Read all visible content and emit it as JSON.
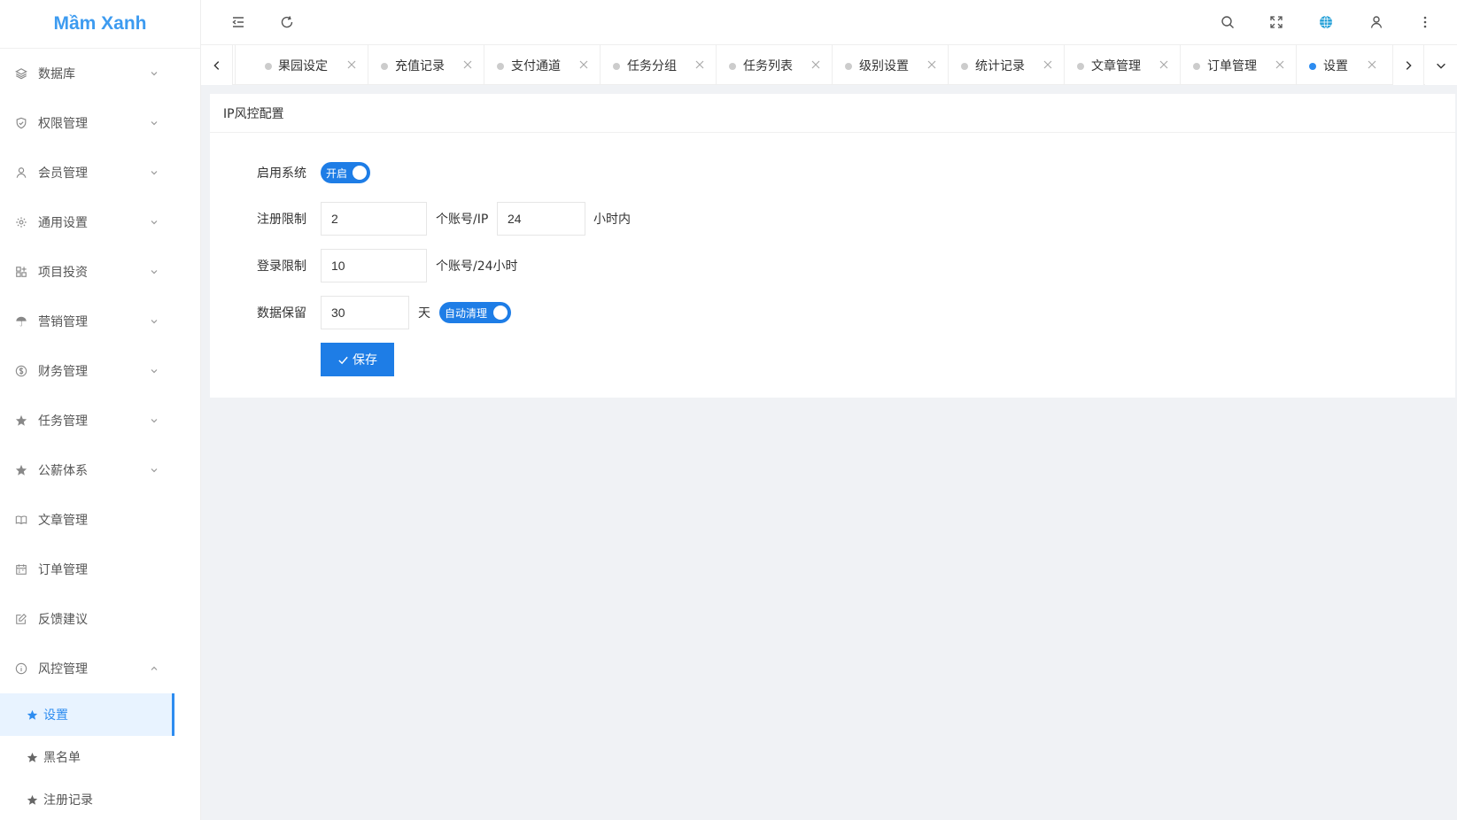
{
  "app": {
    "logo": "Mầm Xanh"
  },
  "sidebar": {
    "items": [
      {
        "label": "数据库",
        "icon": "layers-icon"
      },
      {
        "label": "权限管理",
        "icon": "shield-icon"
      },
      {
        "label": "会员管理",
        "icon": "user-icon"
      },
      {
        "label": "通用设置",
        "icon": "gear-icon"
      },
      {
        "label": "项目投资",
        "icon": "grid-icon"
      },
      {
        "label": "营销管理",
        "icon": "umbrella-icon"
      },
      {
        "label": "财务管理",
        "icon": "dollar-icon"
      },
      {
        "label": "任务管理",
        "icon": "star-icon"
      },
      {
        "label": "公薪体系",
        "icon": "star-icon"
      },
      {
        "label": "文章管理",
        "icon": "book-icon"
      },
      {
        "label": "订单管理",
        "icon": "calendar-icon"
      },
      {
        "label": "反馈建议",
        "icon": "edit-icon"
      },
      {
        "label": "风控管理",
        "icon": "info-icon"
      }
    ],
    "subitems": [
      {
        "label": "设置"
      },
      {
        "label": "黑名单"
      },
      {
        "label": "注册记录"
      }
    ]
  },
  "tabs": [
    {
      "label": "果园设定"
    },
    {
      "label": "充值记录"
    },
    {
      "label": "支付通道"
    },
    {
      "label": "任务分组"
    },
    {
      "label": "任务列表"
    },
    {
      "label": "级别设置"
    },
    {
      "label": "统计记录"
    },
    {
      "label": "文章管理"
    },
    {
      "label": "订单管理"
    },
    {
      "label": "设置"
    }
  ],
  "card": {
    "title": "IP风控配置",
    "enable": {
      "label": "启用系统",
      "switch_text": "开启"
    },
    "register": {
      "label": "注册限制",
      "accounts": "2",
      "unit1": "个账号/IP",
      "hours": "24",
      "unit2": "小时内"
    },
    "login": {
      "label": "登录限制",
      "accounts": "10",
      "unit": "个账号/24小时"
    },
    "retention": {
      "label": "数据保留",
      "days": "30",
      "unit": "天",
      "switch_text": "自动清理"
    },
    "save_label": "保存"
  },
  "colors": {
    "accent": "#1e7de6",
    "logo": "#3d9bf0"
  }
}
